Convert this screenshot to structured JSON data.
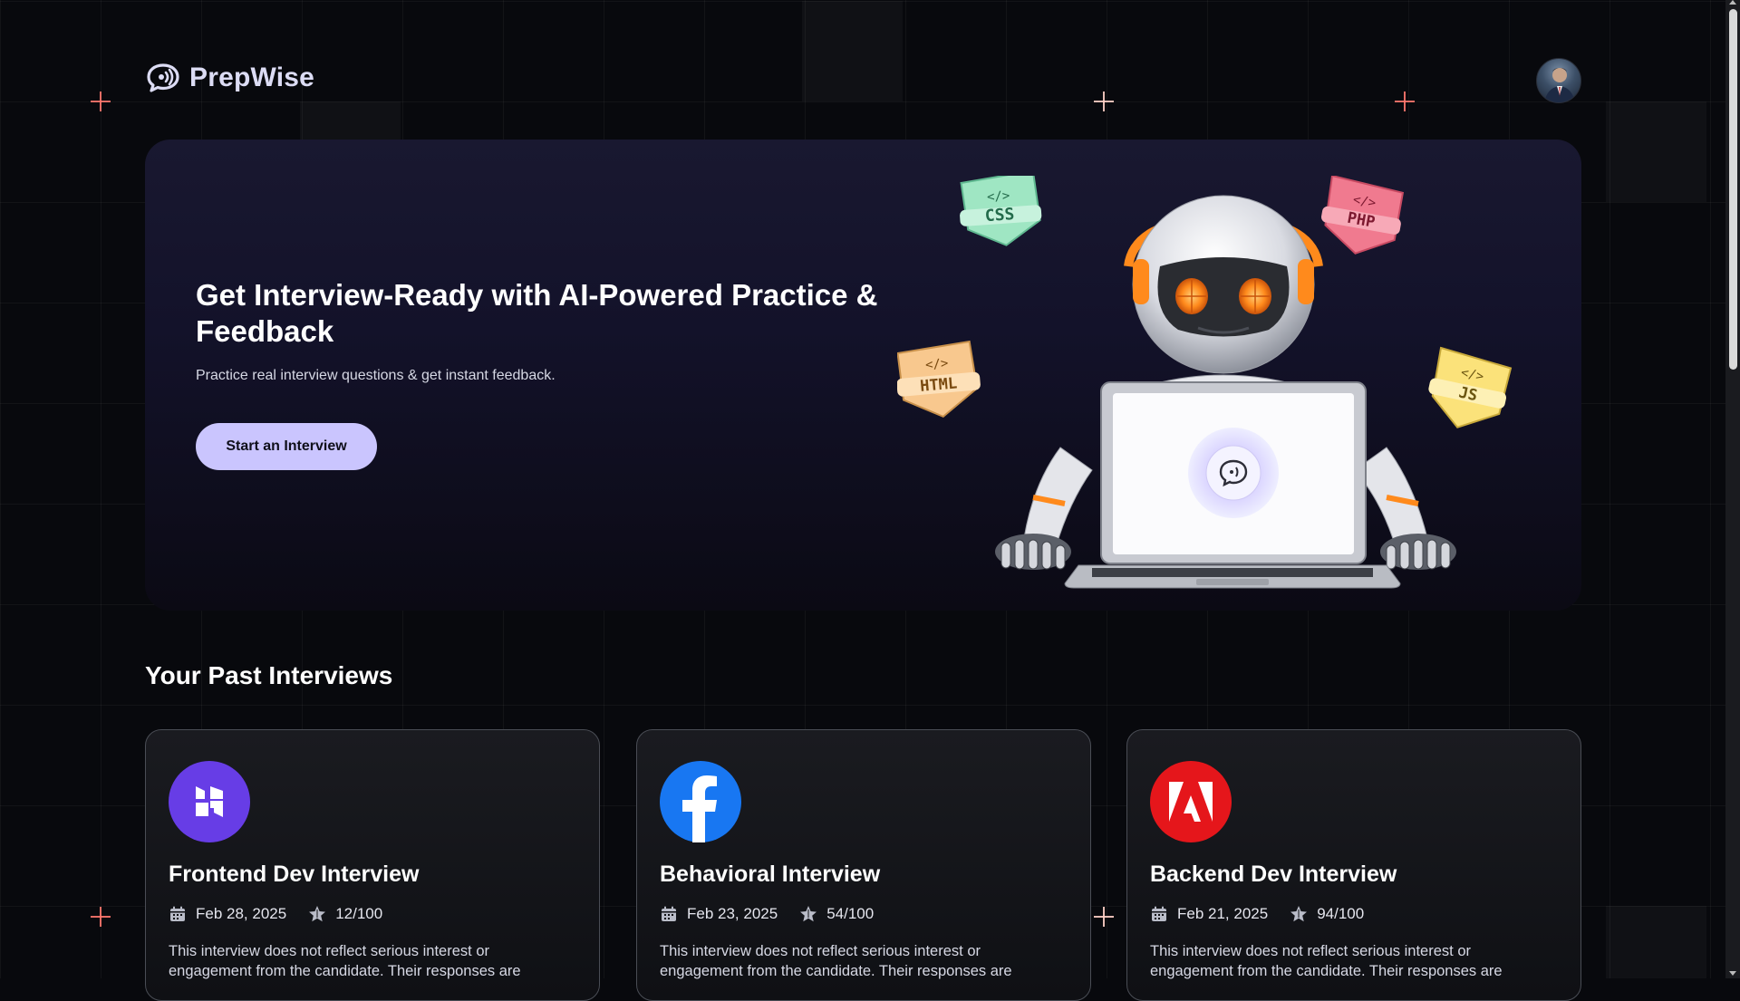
{
  "brand": {
    "name": "PrepWise",
    "logo_icon": "chat-bubble-sound-icon",
    "accent": "#cac5fe"
  },
  "user": {
    "avatar_icon": "user-avatar"
  },
  "hero": {
    "title": "Get Interview-Ready with AI-Powered Practice & Feedback",
    "subtitle": "Practice real interview questions & get instant feedback.",
    "cta_label": "Start an Interview",
    "illustration_badges": [
      "CSS",
      "PHP",
      "HTML",
      "JS"
    ]
  },
  "past_interviews": {
    "title": "Your Past Interviews",
    "cards": [
      {
        "title": "Frontend Dev Interview",
        "date": "Feb 28, 2025",
        "score": "12/100",
        "description": "This interview does not reflect serious interest or engagement from the candidate. Their responses are",
        "logo": "hostinger-logo",
        "logo_color": "#673de6"
      },
      {
        "title": "Behavioral Interview",
        "date": "Feb 23, 2025",
        "score": "54/100",
        "description": "This interview does not reflect serious interest or engagement from the candidate. Their responses are",
        "logo": "facebook-logo",
        "logo_color": "#1877f2"
      },
      {
        "title": "Backend Dev Interview",
        "date": "Feb 21, 2025",
        "score": "94/100",
        "description": "This interview does not reflect serious interest or engagement from the candidate. Their responses are",
        "logo": "adobe-logo",
        "logo_color": "#e5161b"
      }
    ]
  }
}
